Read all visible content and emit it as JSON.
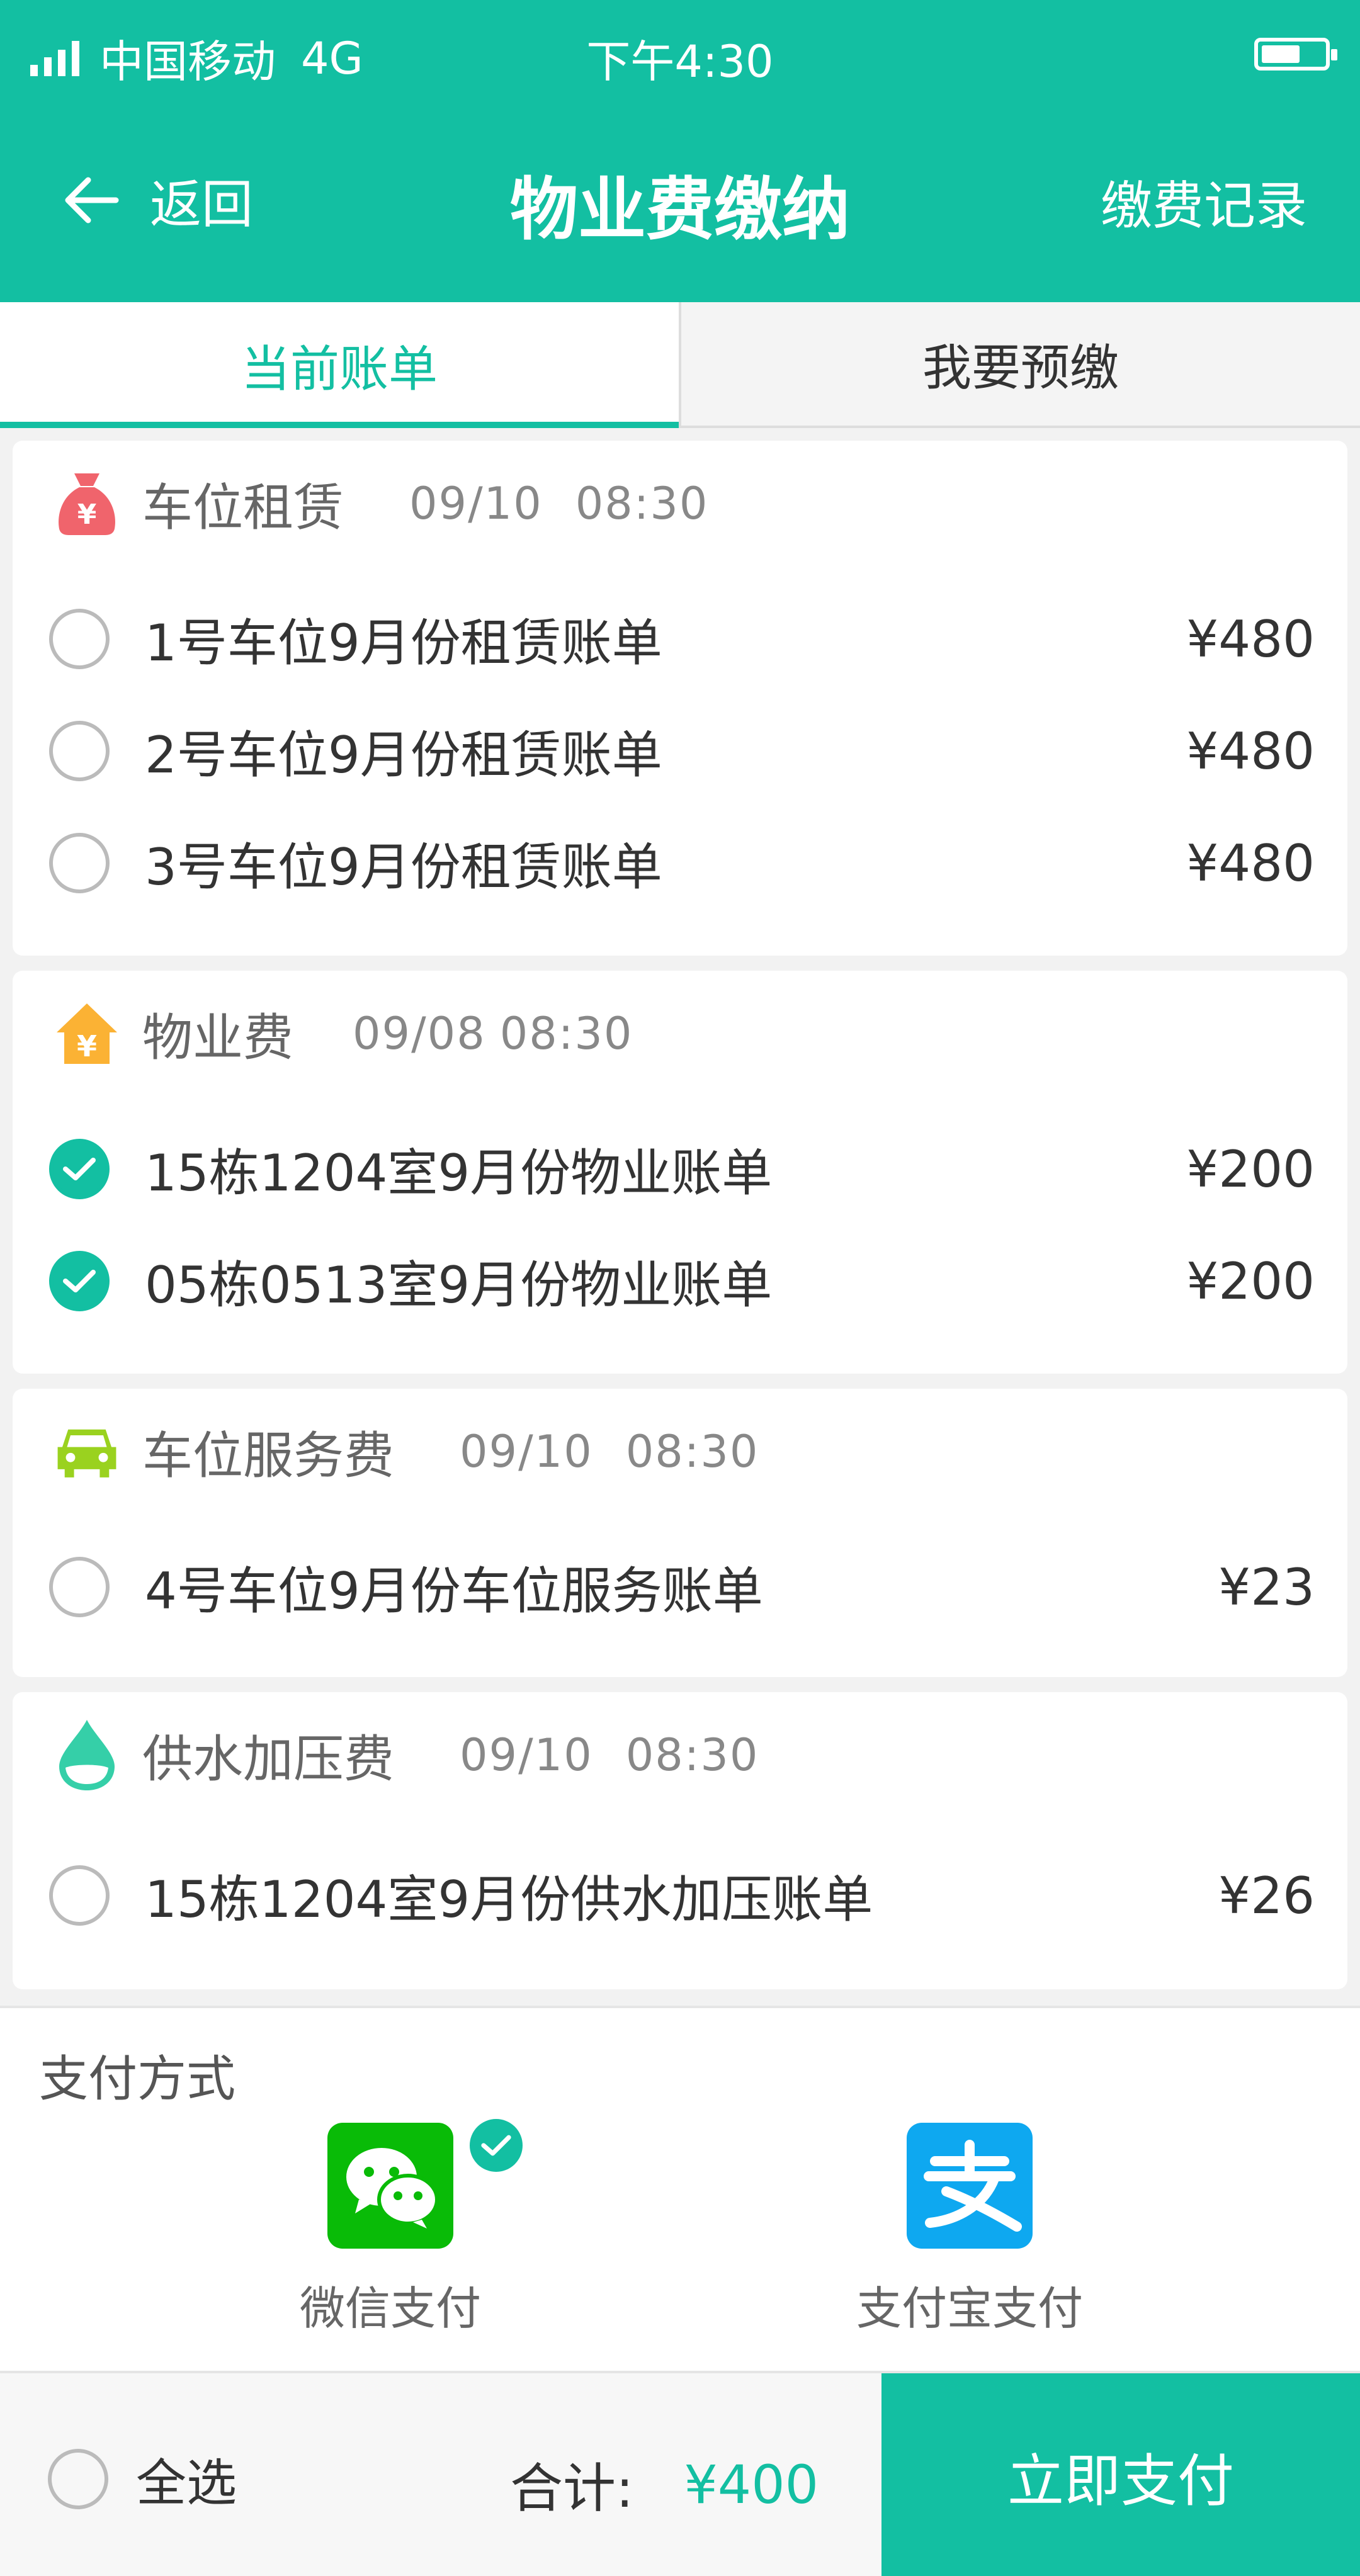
{
  "status_bar": {
    "carrier": "中国移动",
    "network": "4G",
    "time": "下午4:30"
  },
  "navbar": {
    "back_label": "返回",
    "title": "物业费缴纳",
    "right_link": "缴费记录"
  },
  "tabs": [
    {
      "label": "当前账单",
      "active": true
    },
    {
      "label": "我要预缴",
      "active": false
    }
  ],
  "bill_groups": [
    {
      "title": "车位租赁",
      "date": "09/10",
      "time": "08:30",
      "icon": "money-bag-icon",
      "color": "#f0646c",
      "items": [
        {
          "label": "1号车位9月份租赁账单",
          "amount": "¥480",
          "checked": false
        },
        {
          "label": "2号车位9月份租赁账单",
          "amount": "¥480",
          "checked": false
        },
        {
          "label": "3号车位9月份租赁账单",
          "amount": "¥480",
          "checked": false
        }
      ]
    },
    {
      "title": "物业费",
      "date": "09/08",
      "time": "08:30",
      "icon": "house-yen-icon",
      "color": "#fbb234",
      "items": [
        {
          "label": "15栋1204室9月份物业账单",
          "amount": "¥200",
          "checked": true
        },
        {
          "label": "05栋0513室9月份物业账单",
          "amount": "¥200",
          "checked": true
        }
      ]
    },
    {
      "title": "车位服务费",
      "date": "09/10",
      "time": "08:30",
      "icon": "car-icon",
      "color": "#9ad21f",
      "items": [
        {
          "label": "4号车位9月份车位服务账单",
          "amount": "¥23",
          "checked": false
        }
      ]
    },
    {
      "title": "供水加压费",
      "date": "09/10",
      "time": "08:30",
      "icon": "water-drop-icon",
      "color": "#35cfa8",
      "items": [
        {
          "label": "15栋1204室9月份供水加压账单",
          "amount": "¥26",
          "checked": false
        }
      ]
    }
  ],
  "payment": {
    "title": "支付方式",
    "methods": [
      {
        "label": "微信支付",
        "icon": "wechat-icon",
        "color": "#09bb07",
        "selected": true
      },
      {
        "label": "支付宝支付",
        "icon": "alipay-icon",
        "color": "#0ea8f0",
        "selected": false
      }
    ]
  },
  "footer": {
    "select_all": "全选",
    "total_label": "合计:",
    "total_value": "¥400",
    "pay_button": "立即支付"
  },
  "colors": {
    "accent": "#13bfa2"
  }
}
